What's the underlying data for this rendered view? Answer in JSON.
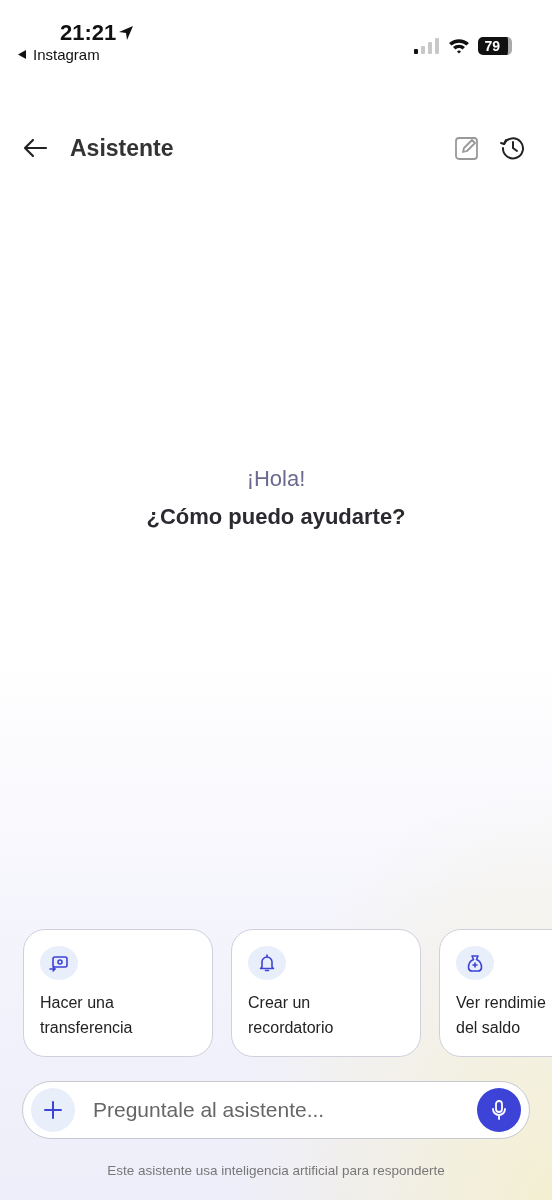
{
  "status_bar": {
    "time": "21:21",
    "back_app": "Instagram",
    "battery": "79"
  },
  "header": {
    "title": "Asistente"
  },
  "greeting": {
    "hello": "¡Hola!",
    "question": "¿Cómo puedo ayudarte?"
  },
  "suggestions": [
    {
      "kind": "transfer",
      "lines": [
        "Hacer una",
        "transferencia"
      ]
    },
    {
      "kind": "reminder",
      "lines": [
        "Crear un",
        "recordatorio"
      ]
    },
    {
      "kind": "savings",
      "lines": [
        "Ver rendimie",
        "del saldo"
      ]
    }
  ],
  "composer": {
    "placeholder": "Preguntale al asistente..."
  },
  "disclaimer": "Este asistente usa inteligencia artificial para responderte"
}
